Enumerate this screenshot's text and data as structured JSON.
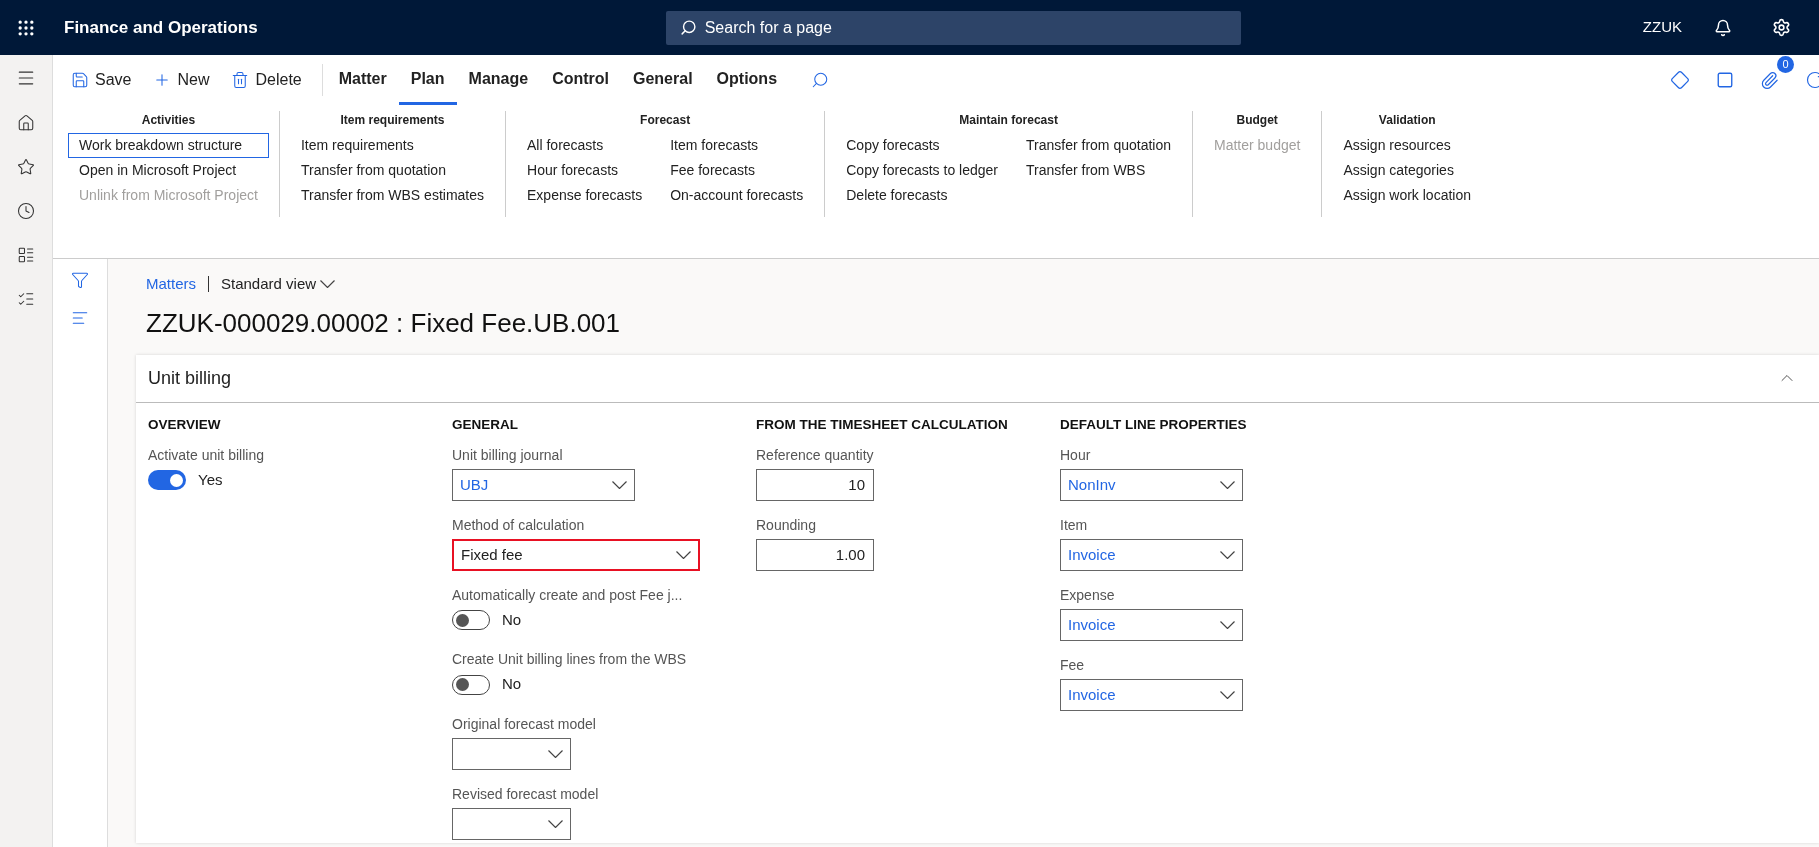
{
  "header": {
    "app_title": "Finance and Operations",
    "search_placeholder": "Search for a page",
    "company": "ZZUK"
  },
  "toolbar": {
    "actions": [
      {
        "kind": "save",
        "label": "Save"
      },
      {
        "kind": "new",
        "label": "New"
      },
      {
        "kind": "delete",
        "label": "Delete"
      }
    ],
    "tabs": [
      {
        "label": "Matter",
        "selected": false
      },
      {
        "label": "Plan",
        "selected": true
      },
      {
        "label": "Manage",
        "selected": false
      },
      {
        "label": "Control",
        "selected": false
      },
      {
        "label": "General",
        "selected": false
      },
      {
        "label": "Options",
        "selected": false
      }
    ],
    "attachments_count": "0"
  },
  "ribbon": [
    {
      "title": "Activities",
      "columns": [
        [
          {
            "label": "Work breakdown structure",
            "disabled": false,
            "selected": true
          },
          {
            "label": "Open in Microsoft Project",
            "disabled": false,
            "selected": false
          },
          {
            "label": "Unlink from Microsoft Project",
            "disabled": true,
            "selected": false
          }
        ]
      ]
    },
    {
      "title": "Item requirements",
      "columns": [
        [
          {
            "label": "Item requirements",
            "disabled": false,
            "selected": false
          },
          {
            "label": "Transfer from quotation",
            "disabled": false,
            "selected": false
          },
          {
            "label": "Transfer from WBS estimates",
            "disabled": false,
            "selected": false
          }
        ]
      ]
    },
    {
      "title": "Forecast",
      "columns": [
        [
          {
            "label": "All forecasts",
            "disabled": false,
            "selected": false
          },
          {
            "label": "Hour forecasts",
            "disabled": false,
            "selected": false
          },
          {
            "label": "Expense forecasts",
            "disabled": false,
            "selected": false
          }
        ],
        [
          {
            "label": "Item forecasts",
            "disabled": false,
            "selected": false
          },
          {
            "label": "Fee forecasts",
            "disabled": false,
            "selected": false
          },
          {
            "label": "On-account forecasts",
            "disabled": false,
            "selected": false
          }
        ]
      ]
    },
    {
      "title": "Maintain forecast",
      "columns": [
        [
          {
            "label": "Copy forecasts",
            "disabled": false,
            "selected": false
          },
          {
            "label": "Copy forecasts to ledger",
            "disabled": false,
            "selected": false
          },
          {
            "label": "Delete forecasts",
            "disabled": false,
            "selected": false
          }
        ],
        [
          {
            "label": "Transfer from quotation",
            "disabled": false,
            "selected": false
          },
          {
            "label": "Transfer from WBS",
            "disabled": false,
            "selected": false
          }
        ]
      ]
    },
    {
      "title": "Budget",
      "columns": [
        [
          {
            "label": "Matter budget",
            "disabled": true,
            "selected": false
          }
        ]
      ]
    },
    {
      "title": "Validation",
      "columns": [
        [
          {
            "label": "Assign resources",
            "disabled": false,
            "selected": false
          },
          {
            "label": "Assign categories",
            "disabled": false,
            "selected": false
          },
          {
            "label": "Assign work location",
            "disabled": false,
            "selected": false
          }
        ]
      ]
    }
  ],
  "breadcrumb": {
    "link": "Matters",
    "view": "Standard view"
  },
  "page_title": "ZZUK-000029.00002 : Fixed Fee.UB.001",
  "card": {
    "title": "Unit billing",
    "expanded": true,
    "sections": [
      {
        "heading": "OVERVIEW",
        "fields": [
          {
            "kind": "toggle",
            "label": "Activate unit billing",
            "on": true,
            "value": "Yes",
            "highlighted": false
          }
        ]
      },
      {
        "heading": "GENERAL",
        "fields": [
          {
            "kind": "select",
            "label": "Unit billing journal",
            "value": "UBJ",
            "highlighted": false
          },
          {
            "kind": "select",
            "label": "Method of calculation",
            "value": "Fixed fee",
            "highlighted": true
          },
          {
            "kind": "toggle",
            "label": "Automatically create and post Fee j...",
            "on": false,
            "value": "No",
            "highlighted": false
          },
          {
            "kind": "toggle",
            "label": "Create Unit billing lines from the WBS",
            "on": false,
            "value": "No",
            "highlighted": false
          },
          {
            "kind": "select",
            "label": "Original forecast model",
            "highlighted": false
          },
          {
            "kind": "select",
            "label": "Revised forecast model",
            "highlighted": false
          }
        ]
      },
      {
        "heading": "FROM THE TIMESHEET CALCULATION",
        "fields": [
          {
            "kind": "number",
            "label": "Reference quantity",
            "value": "10",
            "highlighted": false
          },
          {
            "kind": "number",
            "label": "Rounding",
            "value": "1.00",
            "highlighted": false
          }
        ]
      },
      {
        "heading": "DEFAULT LINE PROPERTIES",
        "fields": [
          {
            "kind": "select",
            "label": "Hour",
            "value": "NonInv",
            "highlighted": false
          },
          {
            "kind": "select",
            "label": "Item",
            "value": "Invoice",
            "highlighted": false
          },
          {
            "kind": "select",
            "label": "Expense",
            "value": "Invoice",
            "highlighted": false
          },
          {
            "kind": "select",
            "label": "Fee",
            "value": "Invoice",
            "highlighted": false
          }
        ]
      }
    ]
  }
}
